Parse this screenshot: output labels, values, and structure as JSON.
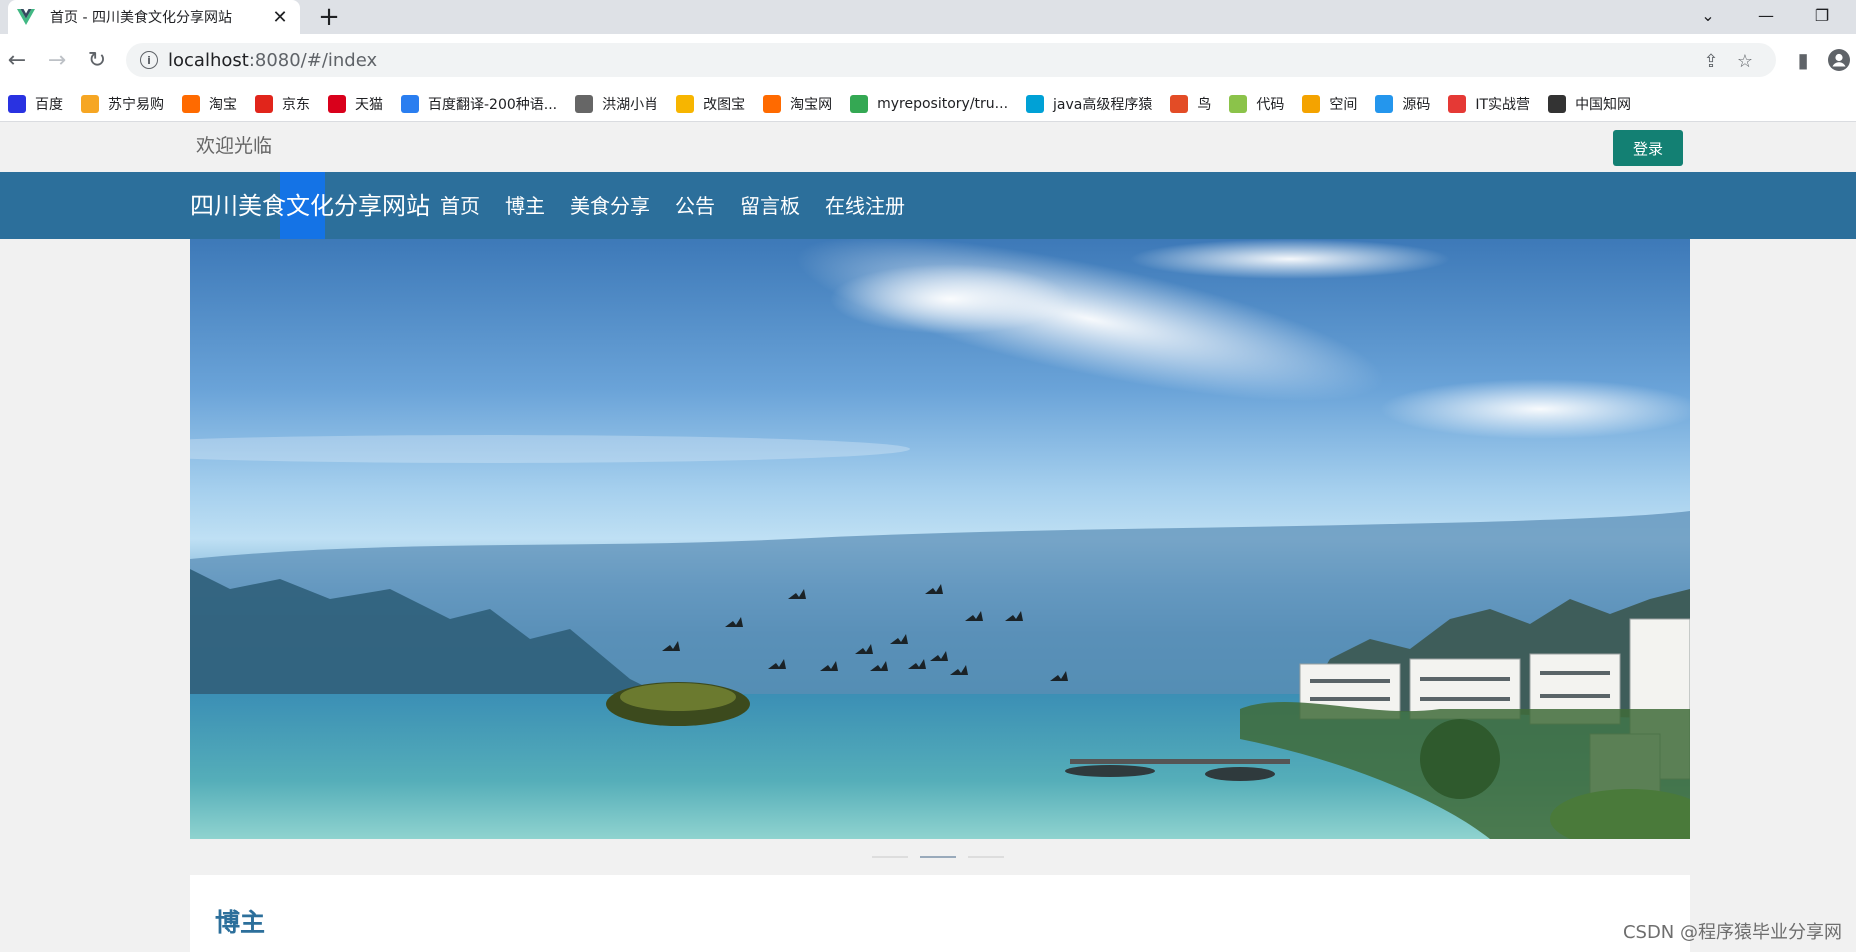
{
  "browser": {
    "tab_title": "首页 - 四川美食文化分享网站",
    "url_host": "localhost",
    "url_path": ":8080/#/index",
    "bookmarks": [
      {
        "label": "百度",
        "icon": "baidu-paw-icon",
        "color": "#2932e1"
      },
      {
        "label": "苏宁易购",
        "icon": "suning-lion-icon",
        "color": "#f6a623"
      },
      {
        "label": "淘宝",
        "icon": "taobao-icon",
        "color": "#ff6a00"
      },
      {
        "label": "京东",
        "icon": "jd-icon",
        "color": "#e1251b"
      },
      {
        "label": "天猫",
        "icon": "tmall-icon",
        "color": "#d9001b"
      },
      {
        "label": "百度翻译-200种语...",
        "icon": "baidu-translate-icon",
        "color": "#2a7ef0"
      },
      {
        "label": "洪湖小肖",
        "icon": "feather-icon",
        "color": "#666666"
      },
      {
        "label": "改图宝",
        "icon": "gaitubao-icon",
        "color": "#f7b500"
      },
      {
        "label": "淘宝网",
        "icon": "taobao-icon",
        "color": "#ff6a00"
      },
      {
        "label": "myrepository/tru...",
        "icon": "chrome-icon",
        "color": "#34a853"
      },
      {
        "label": "java高级程序猿",
        "icon": "bilibili-icon",
        "color": "#00a1d6"
      },
      {
        "label": "鸟",
        "icon": "bird-icon",
        "color": "#e34c26"
      },
      {
        "label": "代码",
        "icon": "code-icon",
        "color": "#8bc34a"
      },
      {
        "label": "空间",
        "icon": "qzone-icon",
        "color": "#f4a300"
      },
      {
        "label": "源码",
        "icon": "docker-icon",
        "color": "#2496ed"
      },
      {
        "label": "IT实战营",
        "icon": "chrome-red-icon",
        "color": "#e53935"
      },
      {
        "label": "中国知网",
        "icon": "cnki-icon",
        "color": "#333333"
      }
    ]
  },
  "topbar": {
    "welcome": "欢迎光临",
    "login_label": "登录"
  },
  "navbar": {
    "brand": "四川美食文化分享网站",
    "links": [
      "首页",
      "博主",
      "美食分享",
      "公告",
      "留言板",
      "在线注册"
    ]
  },
  "section": {
    "title": "博主"
  },
  "watermark": "CSDN @程序猿毕业分享网",
  "colors": {
    "nav_bg": "#2c6f9b",
    "login_bg": "#138073",
    "brand_highlight": "#1473e6"
  }
}
